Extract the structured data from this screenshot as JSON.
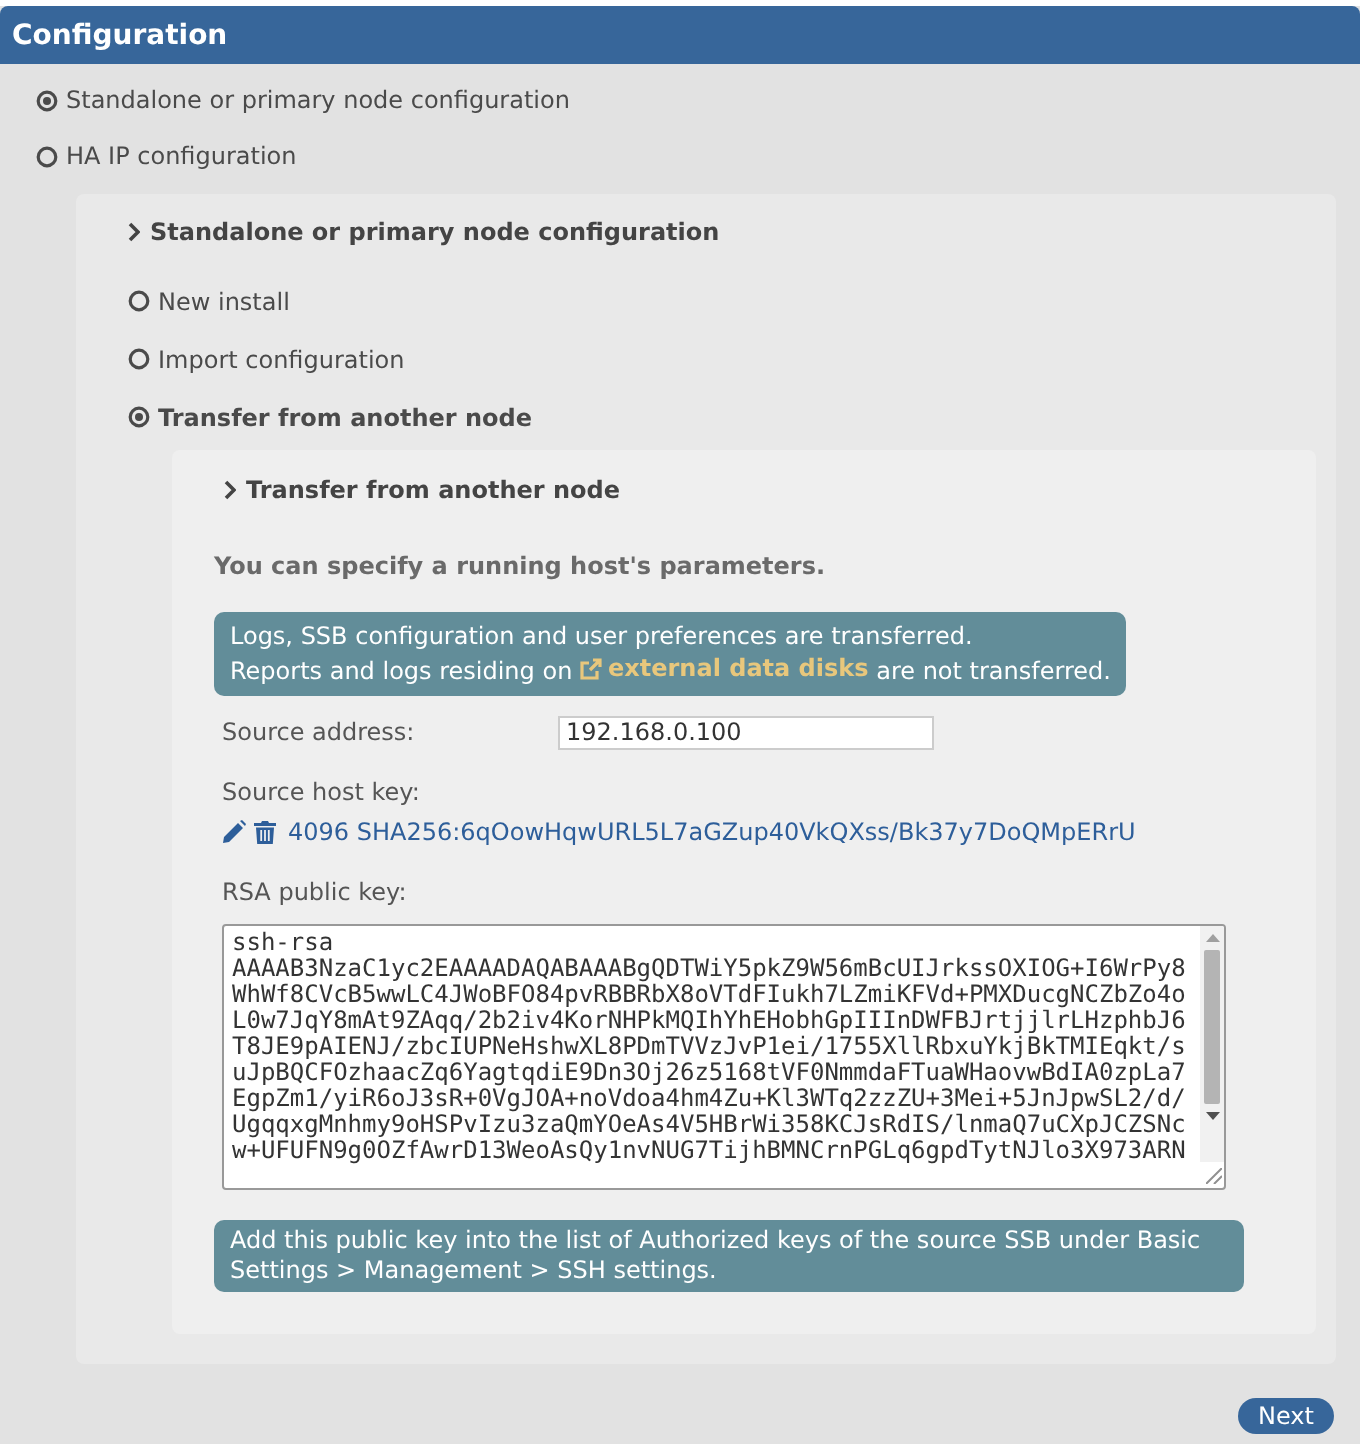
{
  "window": {
    "title": "Configuration"
  },
  "mode_options": [
    {
      "label": "Standalone or primary node configuration",
      "selected": true
    },
    {
      "label": "HA IP configuration",
      "selected": false
    }
  ],
  "node_section": {
    "title": "Standalone or primary node configuration",
    "options": [
      {
        "label": "New install",
        "selected": false
      },
      {
        "label": "Import configuration",
        "selected": false
      },
      {
        "label": "Transfer from another node",
        "selected": true
      }
    ]
  },
  "transfer_section": {
    "title": "Transfer from another node",
    "intro": "You can specify a running host's parameters.",
    "notice": {
      "line_1": "Logs, SSB configuration and user preferences are transferred.",
      "line_2_start": "Reports and logs residing on",
      "link": "external data disks",
      "line_2_end": "are not transferred."
    },
    "source_address": {
      "label": "Source address:",
      "value": "192.168.0.100"
    },
    "source_host_key": {
      "label": "Source host key:",
      "value": "4096 SHA256:6qOowHqwURL5L7aGZup40VkQXss/Bk37y7DoQMpERrU"
    },
    "public_key": {
      "label": "RSA public key:",
      "lines": [
        "ssh-rsa",
        "AAAAB3NzaC1yc2EAAAADAQABAAABgQDTWiY5pkZ9W56mBcUIJrkssOXIOG+I6WrPy8",
        "WhWf8CVcB5wwLC4JWoBFO84pvRBBRbX8oVTdFIukh7LZmiKFVd+PMXDucgNCZbZo4o",
        "L0w7JqY8mAt9ZAqq/2b2iv4KorNHPkMQIhYhEHobhGpIIInDWFBJrtjjlrLHzphbJ6",
        "T8JE9pAIENJ/zbcIUPNeHshwXL8PDmTVVzJvP1ei/1755XllRbxuYkjBkTMIEqkt/s",
        "uJpBQCFOzhaacZq6YagtqdiE9Dn3Oj26z5168tVF0NmmdaFTuaWHaovwBdIA0zpLa7",
        "EgpZm1/yiR6oJ3sR+0VgJOA+noVdoa4hm4Zu+Kl3WTq2zzZU+3Mei+5JnJpwSL2/d/",
        "UgqqxgMnhmy9oHSPvIzu3zaQmYOeAs4V5HBrWi358KCJsRdIS/lnmaQ7uCXpJCZSNc",
        "w+UFUFN9g0OZfAwrD13WeoAsQy1nvNUG7TijhBMNCrnPGLq6gpdTytNJlo3X973ARN"
      ]
    },
    "hint": "Add this public key into the list of Authorized keys of the source SSB under Basic Settings > Management > SSH settings."
  },
  "buttons": [
    {
      "label": "Next"
    }
  ]
}
